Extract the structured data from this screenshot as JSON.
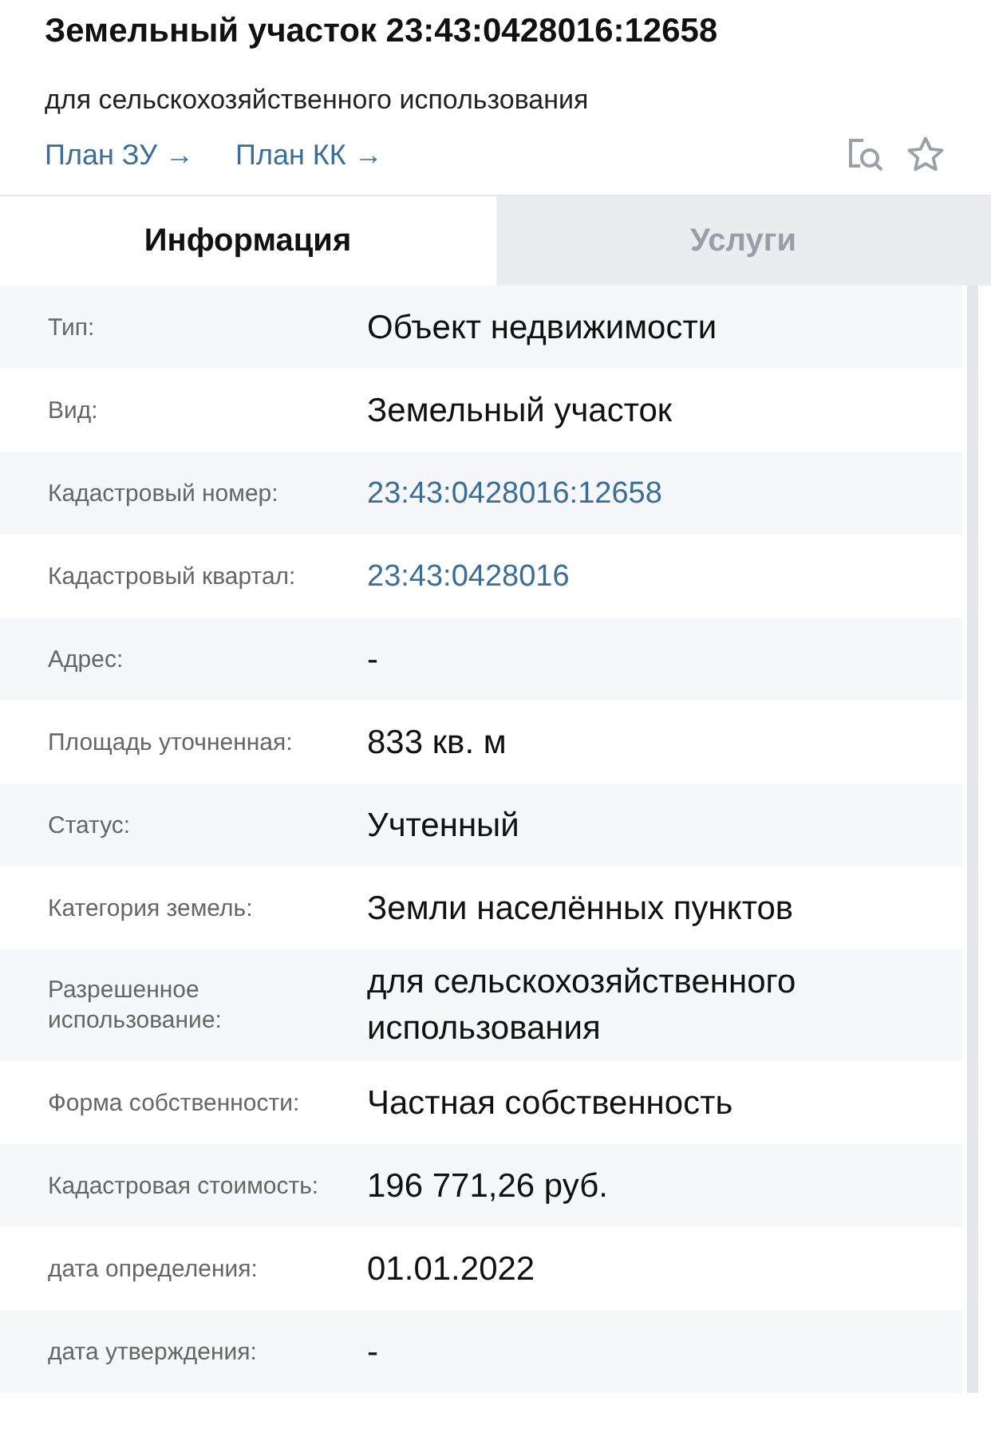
{
  "header": {
    "title": "Земельный участок 23:43:0428016:12658",
    "subtitle": "для сельскохозяйственного использования",
    "links": [
      "План ЗУ →",
      "План КК →"
    ]
  },
  "tabs": [
    {
      "label": "Информация",
      "selected": true
    },
    {
      "label": "Услуги",
      "selected": false
    }
  ],
  "rows": [
    {
      "label": "Тип:",
      "value": "Объект недвижимости",
      "kind": "text"
    },
    {
      "label": "Вид:",
      "value": "Земельный участок",
      "kind": "text"
    },
    {
      "label": "Кадастровый номер:",
      "value": "23:43:0428016:12658",
      "kind": "link"
    },
    {
      "label": "Кадастровый квартал:",
      "value": "23:43:0428016",
      "kind": "link"
    },
    {
      "label": "Адрес:",
      "value": "-",
      "kind": "text"
    },
    {
      "label": "Площадь уточненная:",
      "value": "833 кв. м",
      "kind": "text"
    },
    {
      "label": "Статус:",
      "value": "Учтенный",
      "kind": "text"
    },
    {
      "label": "Категория земель:",
      "value": "Земли населённых пунктов",
      "kind": "text"
    },
    {
      "label": "Разрешенное использование:",
      "value": "для сельскохозяйственного использования",
      "kind": "text"
    },
    {
      "label": "Форма собственности:",
      "value": "Частная собственность",
      "kind": "text"
    },
    {
      "label": "Кадастровая стоимость:",
      "value": "196 771,26 руб.",
      "kind": "text"
    },
    {
      "label": "дата определения:",
      "value": "01.01.2022",
      "kind": "text"
    },
    {
      "label": "дата утверждения:",
      "value": "-",
      "kind": "text"
    }
  ]
}
